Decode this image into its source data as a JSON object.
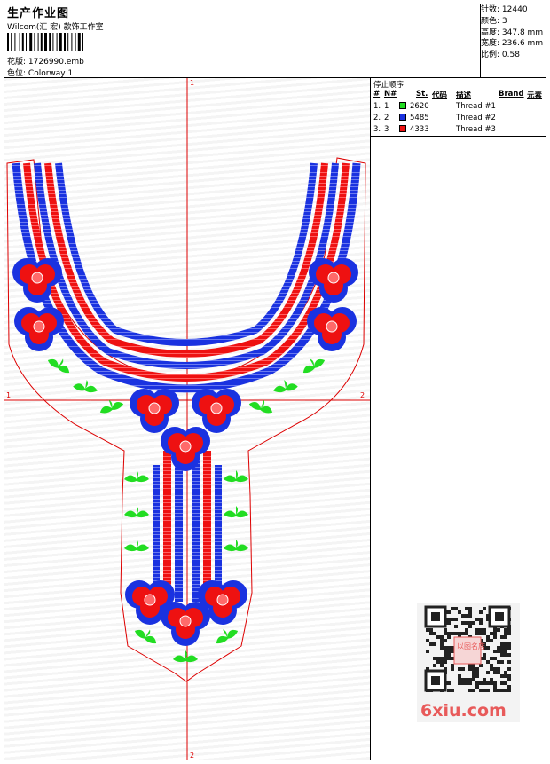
{
  "header": {
    "title": "生产作业图",
    "subtitle": "Wilcom(汇 宏) 款饰工作室",
    "file_label": "花版:",
    "file_value": "1726990.emb",
    "colorway_label": "色位:",
    "colorway_value": "Colorway 1"
  },
  "stats": [
    {
      "label": "针数:",
      "value": "12440"
    },
    {
      "label": "颜色:",
      "value": "3"
    },
    {
      "label": "高度:",
      "value": "347.8 mm"
    },
    {
      "label": "宽度:",
      "value": "236.6 mm"
    },
    {
      "label": "比例:",
      "value": "0.58"
    }
  ],
  "stop_sequence": {
    "title": "停止顺序:",
    "headers": [
      "#",
      "N#",
      "St.",
      "代码",
      "描述",
      "Brand",
      "元素"
    ],
    "rows": [
      {
        "idx": "1.",
        "n": "1",
        "code": "2620",
        "desc": "Thread #1",
        "color": "#22dd22"
      },
      {
        "idx": "2.",
        "n": "2",
        "code": "5485",
        "desc": "Thread #2",
        "color": "#1a32e0"
      },
      {
        "idx": "3.",
        "n": "3",
        "code": "4333",
        "desc": "Thread #3",
        "color": "#ee1111"
      }
    ]
  },
  "axes": {
    "top": "1",
    "bottom": "2",
    "left": "1",
    "right": "2"
  },
  "colors": {
    "green": "#22dd22",
    "blue": "#1a32e0",
    "red": "#ee1111",
    "axis": "#dd0000"
  },
  "watermark": {
    "text": "6xiu.com",
    "stamp": "以图名店"
  }
}
